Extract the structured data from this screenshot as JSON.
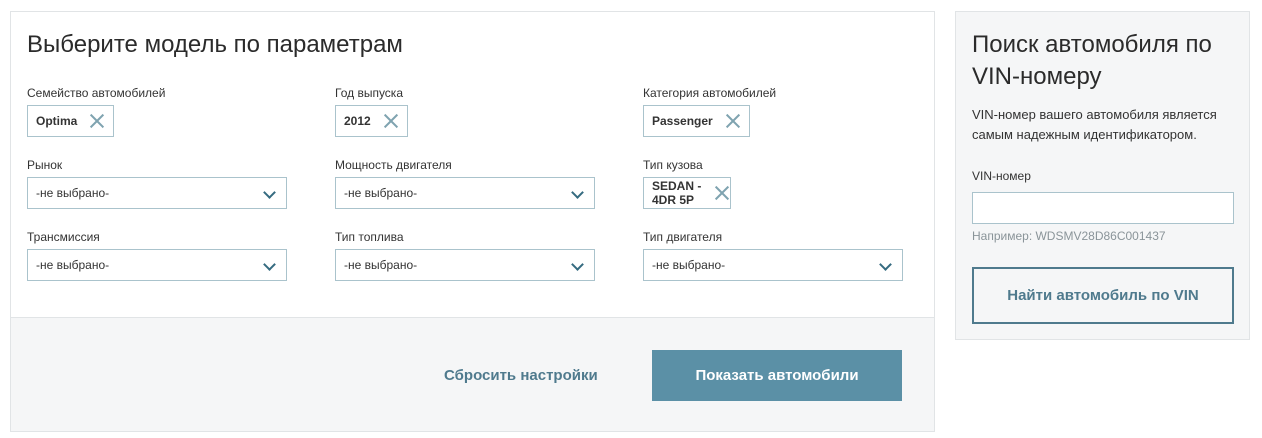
{
  "params": {
    "title": "Выберите модель по параметрам",
    "fields": {
      "family": {
        "label": "Семейство автомобилей",
        "value": "Optima"
      },
      "year": {
        "label": "Год выпуска",
        "value": "2012"
      },
      "category": {
        "label": "Категория автомобилей",
        "value": "Passenger"
      },
      "market": {
        "label": "Рынок",
        "value": "-не выбрано-"
      },
      "power": {
        "label": "Мощность двигателя",
        "value": "-не выбрано-"
      },
      "body": {
        "label": "Тип кузова",
        "value": "SEDAN - 4DR 5P"
      },
      "transmission": {
        "label": "Трансмиссия",
        "value": "-не выбрано-"
      },
      "fuel": {
        "label": "Тип топлива",
        "value": "-не выбрано-"
      },
      "engine": {
        "label": "Тип двигателя",
        "value": "-не выбрано-"
      }
    },
    "reset_label": "Сбросить настройки",
    "show_label": "Показать автомобили"
  },
  "vin": {
    "title": "Поиск автомобиля по VIN-номеру",
    "description": "VIN-номер вашего автомобиля является самым надежным идентификатором.",
    "label": "VIN-номер",
    "value": "",
    "hint": "Например: WDSMV28D86C001437",
    "button_label": "Найти автомобиль по VIN"
  },
  "colors": {
    "accent": "#5b90a6",
    "accent_dark": "#4f7a8d",
    "border": "#aac3cc",
    "panel_bg": "#f5f6f7"
  }
}
